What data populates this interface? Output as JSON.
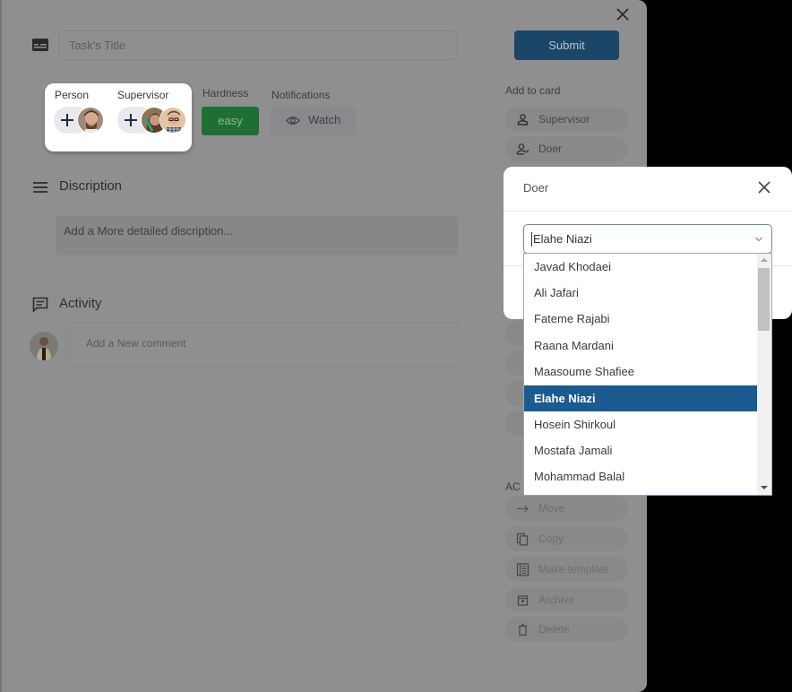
{
  "card": {
    "title_placeholder": "Task's Title",
    "submit_label": "Submit",
    "people": {
      "person_label": "Person",
      "supervisor_label": "Supervisor"
    },
    "hardness": {
      "label": "Hardness",
      "value": "easy",
      "color": "#1f6f34"
    },
    "notifications": {
      "label": "Notifications",
      "watch_label": "Watch"
    },
    "description": {
      "title": "Discription",
      "placeholder": "Add a More detailed discription..."
    },
    "activity": {
      "title": "Activity",
      "comment_placeholder": "Add a New comment"
    }
  },
  "sidebar": {
    "add_to_card_heading": "Add to card",
    "add_items": [
      {
        "label": "Supervisor",
        "icon": "person-icon"
      },
      {
        "label": "Doer",
        "icon": "person-check-icon"
      }
    ],
    "actions_heading": "AC",
    "actions": [
      {
        "label": "Move",
        "icon": "arrow-right-icon"
      },
      {
        "label": "Copy",
        "icon": "copy-icon"
      },
      {
        "label": "Make template",
        "icon": "template-icon"
      },
      {
        "label": "Archive",
        "icon": "archive-icon"
      },
      {
        "label": "Delete",
        "icon": "trash-icon"
      }
    ]
  },
  "doer_popup": {
    "title": "Doer",
    "selected_value": "Elahe Niazi",
    "options": [
      "Javad Khodaei",
      "Ali Jafari",
      "Fateme Rajabi",
      "Raana Mardani",
      "Maasoume Shafiee",
      "Elahe Niazi",
      "Hosein Shirkoul",
      "Mostafa Jamali",
      "Mohammad Balal"
    ],
    "selected_index": 5
  },
  "colors": {
    "primary": "#1b4668",
    "selected_option": "#1b5b8f",
    "easy": "#1f6f34"
  }
}
